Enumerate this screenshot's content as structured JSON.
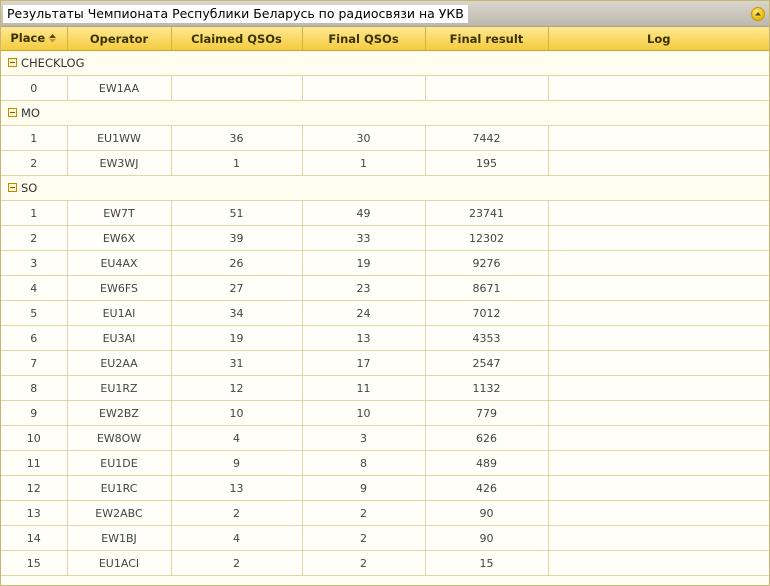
{
  "window": {
    "title": "Результаты Чемпионата Республики Беларусь по радиосвязи на УКВ"
  },
  "columns": {
    "place": "Place",
    "operator": "Operator",
    "claimed": "Claimed QSOs",
    "final": "Final QSOs",
    "result": "Final result",
    "log": "Log"
  },
  "sort": {
    "column": "place",
    "direction": "ascending"
  },
  "groups": [
    {
      "name": "CHECKLOG",
      "rows": [
        {
          "place": "0",
          "operator": "EW1AA",
          "claimed": "",
          "final": "",
          "result": "",
          "log": ""
        }
      ]
    },
    {
      "name": "MO",
      "rows": [
        {
          "place": "1",
          "operator": "EU1WW",
          "claimed": "36",
          "final": "30",
          "result": "7442",
          "log": ""
        },
        {
          "place": "2",
          "operator": "EW3WJ",
          "claimed": "1",
          "final": "1",
          "result": "195",
          "log": ""
        }
      ]
    },
    {
      "name": "SO",
      "rows": [
        {
          "place": "1",
          "operator": "EW7T",
          "claimed": "51",
          "final": "49",
          "result": "23741",
          "log": ""
        },
        {
          "place": "2",
          "operator": "EW6X",
          "claimed": "39",
          "final": "33",
          "result": "12302",
          "log": ""
        },
        {
          "place": "3",
          "operator": "EU4AX",
          "claimed": "26",
          "final": "19",
          "result": "9276",
          "log": ""
        },
        {
          "place": "4",
          "operator": "EW6FS",
          "claimed": "27",
          "final": "23",
          "result": "8671",
          "log": ""
        },
        {
          "place": "5",
          "operator": "EU1AI",
          "claimed": "34",
          "final": "24",
          "result": "7012",
          "log": ""
        },
        {
          "place": "6",
          "operator": "EU3AI",
          "claimed": "19",
          "final": "13",
          "result": "4353",
          "log": ""
        },
        {
          "place": "7",
          "operator": "EU2AA",
          "claimed": "31",
          "final": "17",
          "result": "2547",
          "log": ""
        },
        {
          "place": "8",
          "operator": "EU1RZ",
          "claimed": "12",
          "final": "11",
          "result": "1132",
          "log": ""
        },
        {
          "place": "9",
          "operator": "EW2BZ",
          "claimed": "10",
          "final": "10",
          "result": "779",
          "log": ""
        },
        {
          "place": "10",
          "operator": "EW8OW",
          "claimed": "4",
          "final": "3",
          "result": "626",
          "log": ""
        },
        {
          "place": "11",
          "operator": "EU1DE",
          "claimed": "9",
          "final": "8",
          "result": "489",
          "log": ""
        },
        {
          "place": "12",
          "operator": "EU1RC",
          "claimed": "13",
          "final": "9",
          "result": "426",
          "log": ""
        },
        {
          "place": "13",
          "operator": "EW2ABC",
          "claimed": "2",
          "final": "2",
          "result": "90",
          "log": ""
        },
        {
          "place": "14",
          "operator": "EW1BJ",
          "claimed": "4",
          "final": "2",
          "result": "90",
          "log": ""
        },
        {
          "place": "15",
          "operator": "EU1ACI",
          "claimed": "2",
          "final": "2",
          "result": "15",
          "log": ""
        }
      ]
    }
  ],
  "icons": {
    "collapse": "collapse-up-icon",
    "sort": "sort-ascending-icon",
    "group_toggle": "group-collapse-icon"
  },
  "colors": {
    "header": "#f4cc3f",
    "accent": "#e6b900",
    "border": "#e0d6a6"
  }
}
